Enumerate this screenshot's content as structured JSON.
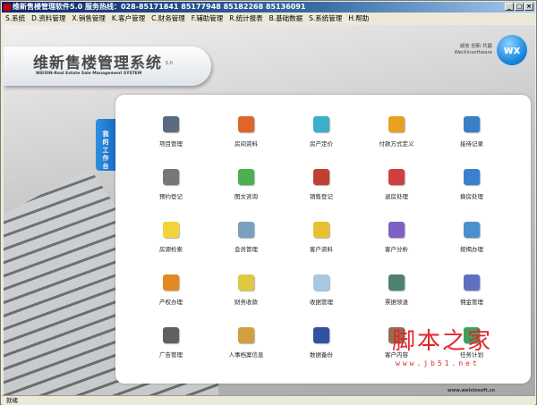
{
  "window": {
    "title": "维新售楼管理软件5.0 服务热线：028-85171841 85177948 85182268 85136091",
    "controls": [
      "_",
      "□",
      "×"
    ]
  },
  "menu": [
    "S.系统",
    "D.资料管理",
    "X.销售管理",
    "K.客户管理",
    "C.财务管理",
    "F.辅助管理",
    "R.统计报表",
    "B.基础数据",
    "S.系统管理",
    "H.帮助"
  ],
  "header": {
    "title": "维新售楼管理系统",
    "version": "5.0",
    "subtitle": "WEIXIN-Real Estate Sale Management SYSTEM",
    "slogan": "诚信 创新 共赢",
    "company": "WeiXinsoftware",
    "logo_text": "wx"
  },
  "sidebar_tab": "我的工作台",
  "workbench": [
    {
      "label": "项目管理",
      "color": "#5a6b80"
    },
    {
      "label": "房间资料",
      "color": "#e0652a"
    },
    {
      "label": "房产定价",
      "color": "#3cb0c8"
    },
    {
      "label": "付款方式定义",
      "color": "#e8a020"
    },
    {
      "label": "接待记录",
      "color": "#3a80c8"
    },
    {
      "label": "预约登记",
      "color": "#777777"
    },
    {
      "label": "图文咨询",
      "color": "#4caf50"
    },
    {
      "label": "销售登记",
      "color": "#c04030"
    },
    {
      "label": "退房处理",
      "color": "#d04040"
    },
    {
      "label": "换房处理",
      "color": "#3a7fd0"
    },
    {
      "label": "房源检索",
      "color": "#f2d43a"
    },
    {
      "label": "会员管理",
      "color": "#7aa0c0"
    },
    {
      "label": "客户资料",
      "color": "#e8c030"
    },
    {
      "label": "客户分析",
      "color": "#8060c0"
    },
    {
      "label": "按揭办理",
      "color": "#4a90d0"
    },
    {
      "label": "产权办理",
      "color": "#e08a20"
    },
    {
      "label": "财务收款",
      "color": "#e0c840"
    },
    {
      "label": "收据管理",
      "color": "#a8c8e0"
    },
    {
      "label": "票据领退",
      "color": "#508070"
    },
    {
      "label": "佣金管理",
      "color": "#6070c0"
    },
    {
      "label": "广告管理",
      "color": "#606060"
    },
    {
      "label": "人事档案信息",
      "color": "#d0a040"
    },
    {
      "label": "数据备份",
      "color": "#3050a0"
    },
    {
      "label": "客户内容",
      "color": "#907050"
    },
    {
      "label": "任务计划",
      "color": "#40a060"
    }
  ],
  "footer": {
    "site": "www.weixinsoft.cn"
  },
  "status": "就绪",
  "watermark": {
    "text": "脚本之家",
    "url": "www.jb51.net"
  }
}
